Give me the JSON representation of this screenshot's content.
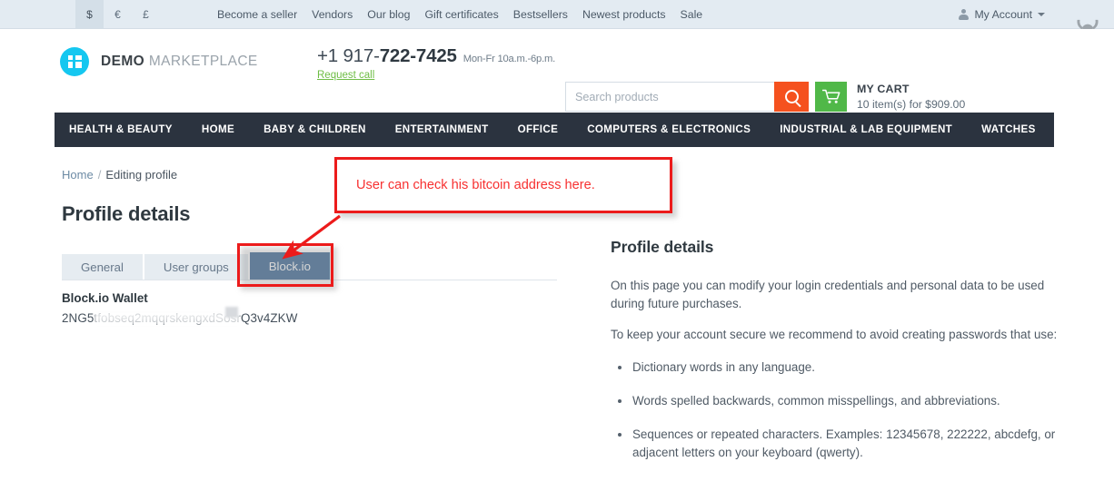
{
  "topbar": {
    "currencies": [
      {
        "symbol": "$",
        "active": true
      },
      {
        "symbol": "€",
        "active": false
      },
      {
        "symbol": "£",
        "active": false
      }
    ],
    "links": [
      "Become a seller",
      "Vendors",
      "Our blog",
      "Gift certificates",
      "Bestsellers",
      "Newest products",
      "Sale"
    ],
    "account_label": "My Account",
    "beetle_icon": "beetle-icon"
  },
  "header": {
    "logo_icon": "demo-marketplace-logo-icon",
    "brand_bold": "DEMO",
    "brand_rest": "MARKETPLACE",
    "phone_prefix": "+1 917-",
    "phone_bold": "722-7425",
    "hours": "Mon-Fr 10a.m.-6p.m.",
    "request_call": "Request call",
    "search": {
      "placeholder": "Search products",
      "value": "",
      "button_icon": "search-icon"
    },
    "cart": {
      "icon": "cart-icon",
      "title": "MY CART",
      "summary": "10 item(s) for $909.00",
      "items": 10,
      "total": "$909.00"
    }
  },
  "nav": {
    "items": [
      "HEALTH & BEAUTY",
      "HOME",
      "BABY & CHILDREN",
      "ENTERTAINMENT",
      "OFFICE",
      "COMPUTERS & ELECTRONICS",
      "INDUSTRIAL & LAB EQUIPMENT",
      "WATCHES"
    ]
  },
  "breadcrumb": {
    "home": "Home",
    "separator": "/",
    "current": "Editing profile"
  },
  "page_title": "Profile details",
  "tabs": [
    {
      "label": "General",
      "active": false
    },
    {
      "label": "User groups",
      "active": false
    },
    {
      "label": "Block.io",
      "active": true
    }
  ],
  "wallet": {
    "label": "Block.io Wallet",
    "address_prefix": "2NG5t",
    "address_hidden": "fobseq2mqqrskengxd",
    "address_suffix": "SosrQ3v4ZKW"
  },
  "sidebar_info": {
    "heading": "Profile details",
    "paragraphs": [
      "On this page you can modify your login credentials and personal data to be used during future purchases.",
      "To keep your account secure we recommend to avoid creating passwords that use:"
    ],
    "bullets": [
      "Dictionary words in any language.",
      "Words spelled backwards, common misspellings, and abbreviations.",
      "Sequences or repeated characters. Examples: 12345678, 222222, abcdefg, or adjacent letters on your keyboard (qwerty)."
    ]
  },
  "annotation": {
    "text": "User can check his bitcoin address here.",
    "color": "#f73030",
    "border_color": "#ec1b1b"
  },
  "colors": {
    "topbar_bg": "#e3ebf2",
    "nav_bg": "#2b333f",
    "accent_orange": "#f5511e",
    "accent_green": "#50b848",
    "logo_cyan": "#15c7f0",
    "active_tab": "#5b80a6",
    "annotation_red": "#ec1b1b"
  }
}
